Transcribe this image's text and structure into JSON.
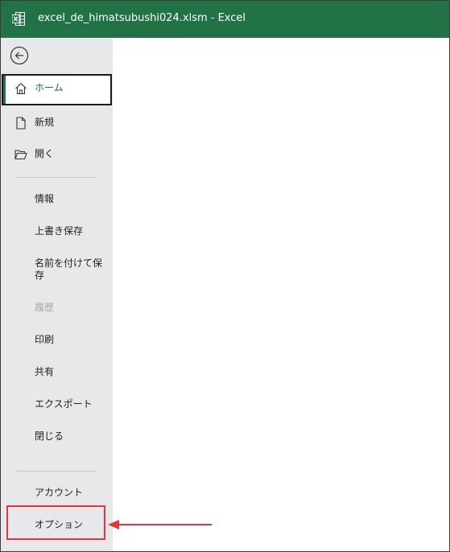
{
  "titlebar": {
    "title": "excel_de_himatsubushi024.xlsm  -  Excel",
    "app_icon": "excel-icon",
    "background_color": "#217346"
  },
  "backstage": {
    "back_icon": "back-arrow-icon",
    "top_items": [
      {
        "label": "ホーム",
        "icon": "home-icon",
        "selected": true
      },
      {
        "label": "新規",
        "icon": "new-document-icon"
      },
      {
        "label": "開く",
        "icon": "open-folder-icon"
      }
    ],
    "middle_items": [
      {
        "label": "情報"
      },
      {
        "label": "上書き保存"
      },
      {
        "label": "名前を付けて保存"
      },
      {
        "label": "履歴",
        "disabled": true
      },
      {
        "label": "印刷"
      },
      {
        "label": "共有"
      },
      {
        "label": "エクスポート"
      },
      {
        "label": "閉じる"
      }
    ],
    "bottom_items": [
      {
        "label": "アカウント"
      },
      {
        "label": "オプション",
        "highlighted": true
      }
    ]
  },
  "annotation": {
    "highlight_color": "#e0383e",
    "arrow_icon": "left-arrow-icon"
  }
}
